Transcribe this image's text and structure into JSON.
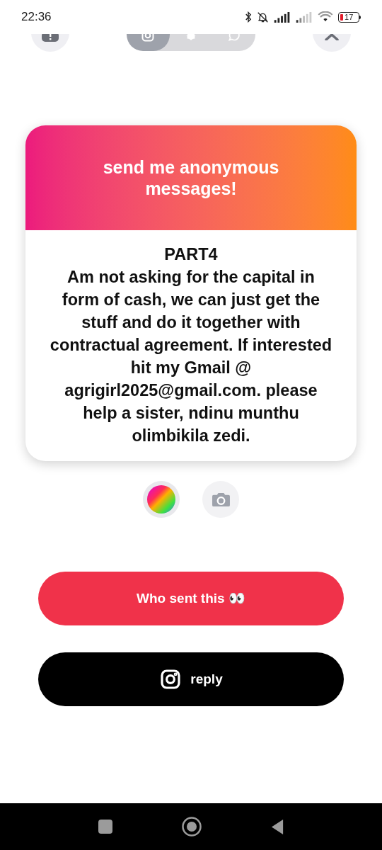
{
  "status_bar": {
    "time": "22:36",
    "battery": {
      "level": 0.17,
      "reading": "17"
    }
  },
  "share_tabs": [
    {
      "kind": "instagram",
      "selected": true
    },
    {
      "kind": "snapchat",
      "selected": false
    },
    {
      "kind": "whatsapp",
      "selected": false
    }
  ],
  "card": {
    "header": "send me anonymous messages!",
    "message": "PART4\nAm not asking for the capital in form of cash, we can just get the stuff and do it together with contractual agreement. If interested hit my Gmail @ agrigirl2025@gmail.com. please help a sister, ndinu munthu olimbikila zedi."
  },
  "buttons": [
    {
      "kind": "primary",
      "label": "Who sent this 👀"
    },
    {
      "kind": "instagram",
      "label": "reply"
    }
  ]
}
